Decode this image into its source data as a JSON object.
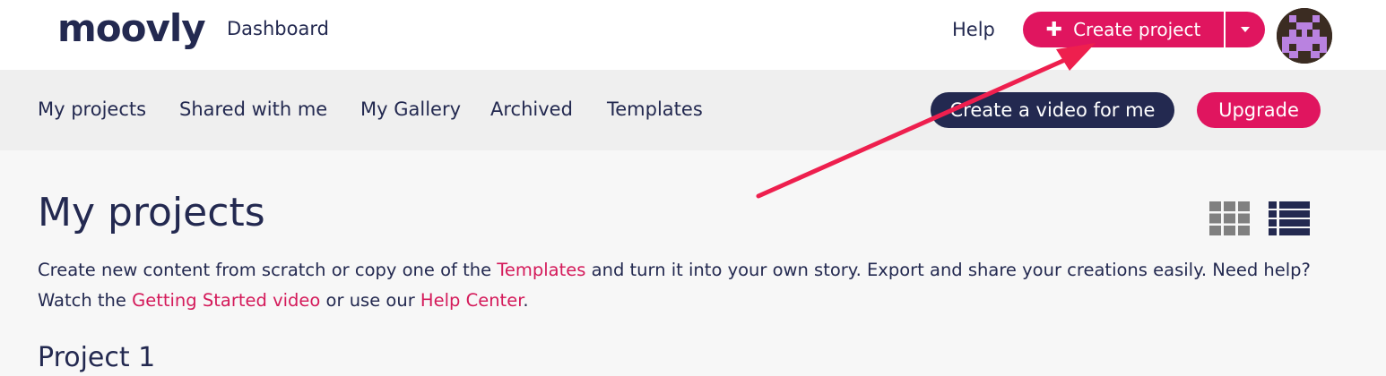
{
  "header": {
    "logo_text": "moovly",
    "dashboard_label": "Dashboard",
    "help_label": "Help",
    "create_project_label": "Create project",
    "avatar_alt": "user avatar"
  },
  "subnav": {
    "items": [
      {
        "label": "My projects"
      },
      {
        "label": "Shared with me"
      },
      {
        "label": "My Gallery"
      },
      {
        "label": "Archived"
      },
      {
        "label": "Templates"
      }
    ],
    "video_button_label": "Create a video for me",
    "upgrade_button_label": "Upgrade"
  },
  "main": {
    "title": "My projects",
    "intro_part1": "Create new content from scratch or copy one of the ",
    "intro_link1": "Templates",
    "intro_part2": " and turn it into your own story. Export and share your creations easily. Need help? Watch the ",
    "intro_link2": "Getting Started video",
    "intro_part3": " or use our ",
    "intro_link3": "Help Center",
    "intro_part4": ".",
    "section_title": "Project 1"
  },
  "colors": {
    "brand_navy": "#232950",
    "brand_pink": "#e0155f",
    "link_pink": "#d41a5a",
    "icon_grey": "#808080",
    "arrow_red": "#ee1f4e"
  },
  "icons": {
    "grid_view": "grid-view-icon",
    "list_view": "list-view-icon",
    "plus": "plus-icon",
    "caret": "caret-down-icon"
  }
}
